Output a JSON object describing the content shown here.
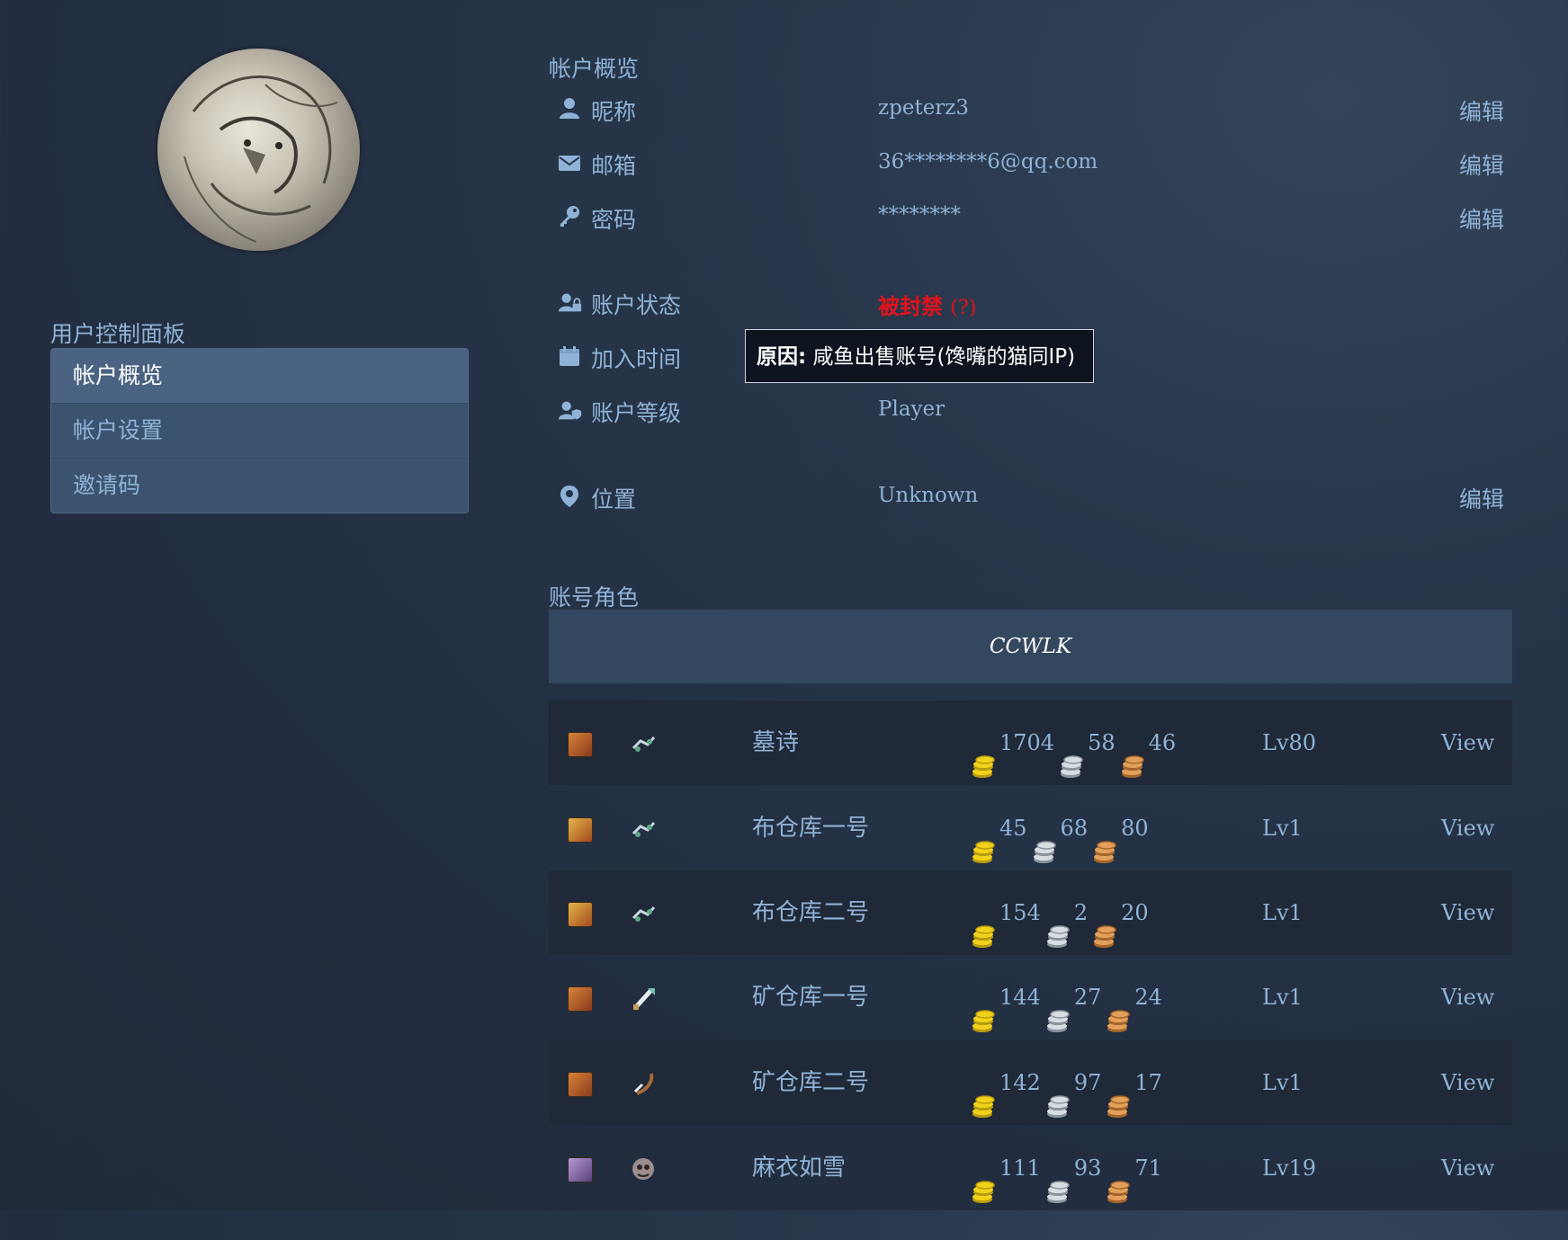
{
  "sidebar": {
    "panel_title": "用户控制面板",
    "items": [
      {
        "label": "帐户概览"
      },
      {
        "label": "帐户设置"
      },
      {
        "label": "邀请码"
      }
    ]
  },
  "overview": {
    "title": "帐户概览",
    "nickname": {
      "label": "昵称",
      "value": "zpeterz3",
      "edit": "编辑"
    },
    "email": {
      "label": "邮箱",
      "value": "36********6@qq.com",
      "edit": "编辑"
    },
    "password": {
      "label": "密码",
      "value": "********",
      "edit": "编辑"
    },
    "status": {
      "label": "账户状态",
      "value": "被封禁",
      "help": "(?)"
    },
    "join": {
      "label": "加入时间"
    },
    "tooltip": {
      "prefix": "原因:",
      "text": "咸鱼出售账号(馋嘴的猫同IP)"
    },
    "rank": {
      "label": "账户等级",
      "value": "Player"
    },
    "location": {
      "label": "位置",
      "value": "Unknown",
      "edit": "编辑"
    }
  },
  "characters": {
    "title": "账号角色",
    "realm": "CCWLK",
    "rows": [
      {
        "name": "墓诗",
        "gold": "1704",
        "silver": "58",
        "copper": "46",
        "level": "Lv80",
        "view": "View",
        "race_icon": "human-female-icon",
        "class_icon": "rogue-class-icon"
      },
      {
        "name": "布仓库一号",
        "gold": "45",
        "silver": "68",
        "copper": "80",
        "level": "Lv1",
        "view": "View",
        "race_icon": "dwarf-female-icon",
        "class_icon": "rogue-class-icon"
      },
      {
        "name": "布仓库二号",
        "gold": "154",
        "silver": "2",
        "copper": "20",
        "level": "Lv1",
        "view": "View",
        "race_icon": "dwarf-female-icon",
        "class_icon": "rogue-class-icon"
      },
      {
        "name": "矿仓库一号",
        "gold": "144",
        "silver": "27",
        "copper": "24",
        "level": "Lv1",
        "view": "View",
        "race_icon": "human-female-icon",
        "class_icon": "warrior-class-icon"
      },
      {
        "name": "矿仓库二号",
        "gold": "142",
        "silver": "97",
        "copper": "17",
        "level": "Lv1",
        "view": "View",
        "race_icon": "human-female-icon",
        "class_icon": "hunter-class-icon"
      },
      {
        "name": "麻衣如雪",
        "gold": "111",
        "silver": "93",
        "copper": "71",
        "level": "Lv19",
        "view": "View",
        "race_icon": "nightelf-female-icon",
        "class_icon": "druid-class-icon"
      }
    ]
  },
  "colors": {
    "text": "#8fb3d6",
    "banned": "#e3121b",
    "gold": "#f1d21a",
    "silver": "#d8dde2",
    "copper": "#e3a05a"
  }
}
